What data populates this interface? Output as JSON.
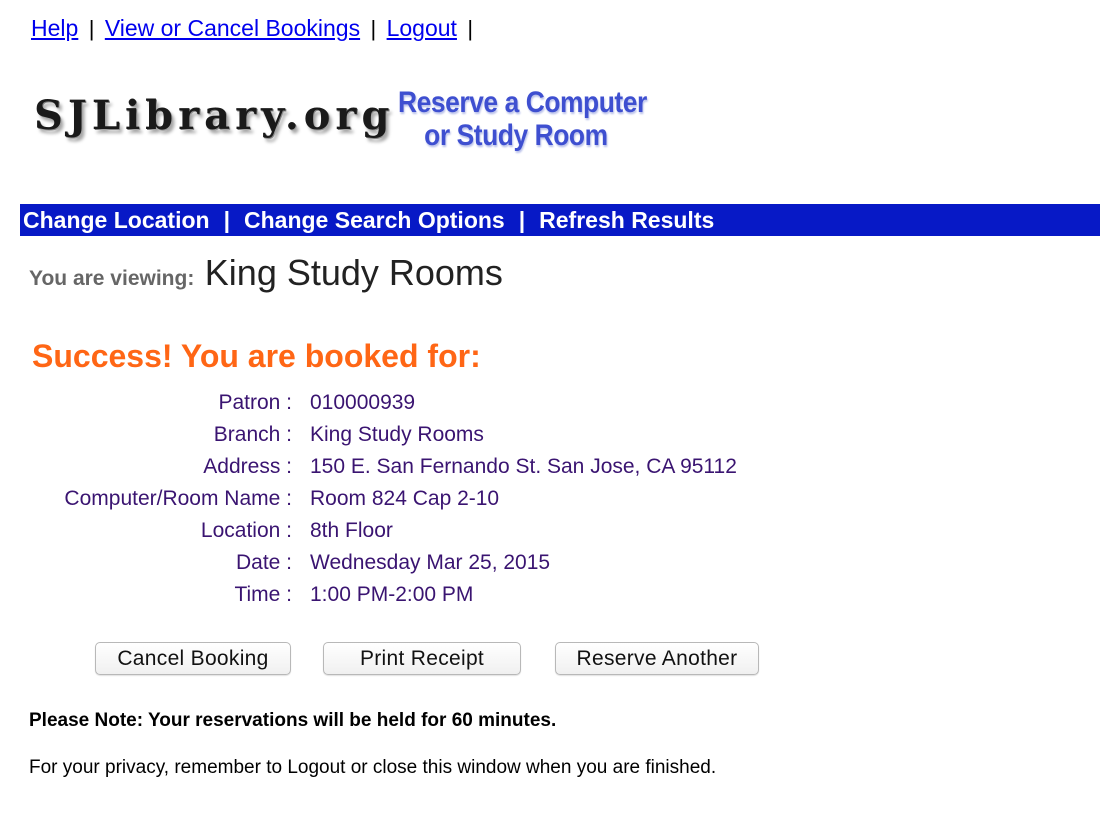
{
  "top_links": {
    "help": "Help",
    "view_cancel": "View or Cancel Bookings",
    "logout": "Logout",
    "separator": "|"
  },
  "logo": {
    "wordmark": "SJLibrary.org",
    "tagline_line1": "Reserve a Computer",
    "tagline_line2": "or Study Room"
  },
  "navbar": {
    "change_location": "Change Location",
    "change_search": "Change Search Options",
    "refresh": "Refresh Results",
    "separator": "|",
    "background_color": "#0719c6"
  },
  "viewing": {
    "label": "You are viewing:",
    "value": "King Study Rooms"
  },
  "success": {
    "title": "Success! You are booked for:",
    "color": "#ff6615"
  },
  "booking": {
    "rows": [
      {
        "label": "Patron :",
        "value": "010000939"
      },
      {
        "label": "Branch :",
        "value": "King Study Rooms"
      },
      {
        "label": "Address :",
        "value": "150 E. San Fernando St. San Jose, CA 95112"
      },
      {
        "label": "Computer/Room Name :",
        "value": "Room 824 Cap 2-10"
      },
      {
        "label": "Location :",
        "value": "8th Floor"
      },
      {
        "label": "Date :",
        "value": "Wednesday Mar 25, 2015"
      },
      {
        "label": "Time :",
        "value": "1:00 PM-2:00 PM"
      }
    ],
    "text_color": "#3a1471"
  },
  "buttons": {
    "cancel": "Cancel Booking",
    "print": "Print Receipt",
    "reserve_another": "Reserve Another"
  },
  "notes": {
    "hold": "Please Note: Your reservations will be held for 60 minutes.",
    "privacy": "For your privacy, remember to Logout or close this window when you are finished."
  }
}
